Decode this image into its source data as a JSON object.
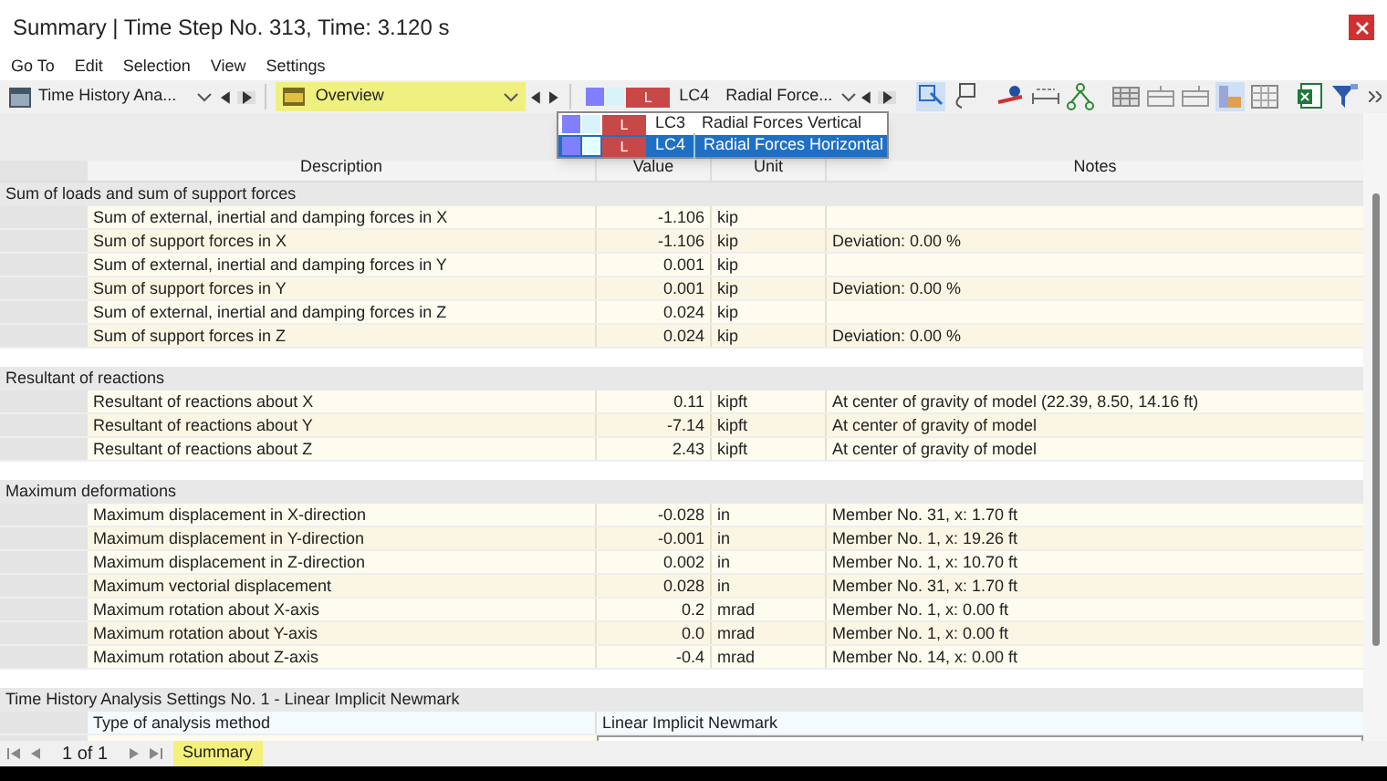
{
  "window": {
    "title": "Summary | Time Step No. 313, Time: 3.120 s"
  },
  "menu": [
    "Go To",
    "Edit",
    "Selection",
    "View",
    "Settings"
  ],
  "toolbar": {
    "analysis_combo": "Time History Ana...",
    "view_combo": "Overview",
    "load_case_combo": {
      "tag": "L",
      "code": "LC4",
      "name": "Radial Force..."
    },
    "load_case_list": [
      {
        "tag": "L",
        "code": "LC3",
        "name": "Radial Forces Vertical",
        "selected": false
      },
      {
        "tag": "L",
        "code": "LC4",
        "name": "Radial Forces Horizontal",
        "selected": true
      }
    ]
  },
  "table": {
    "columns": [
      "Description",
      "Value",
      "Unit",
      "Notes"
    ],
    "sections": [
      {
        "title": "Sum of loads and sum of support forces",
        "rows": [
          {
            "kind": "standard",
            "description": "Sum of external, inertial and damping forces in X",
            "value": "-1.106",
            "unit": "kip"
          },
          {
            "kind": "standard",
            "description": "Sum of support forces in X",
            "value": "-1.106",
            "unit": "kip",
            "notes": "Deviation: 0.00 %"
          },
          {
            "kind": "standard",
            "description": "Sum of external, inertial and damping forces in Y",
            "value": "0.001",
            "unit": "kip"
          },
          {
            "kind": "standard",
            "description": "Sum of support forces in Y",
            "value": "0.001",
            "unit": "kip",
            "notes": "Deviation: 0.00 %"
          },
          {
            "kind": "standard",
            "description": "Sum of external, inertial and damping forces in Z",
            "value": "0.024",
            "unit": "kip"
          },
          {
            "kind": "standard",
            "description": "Sum of support forces in Z",
            "value": "0.024",
            "unit": "kip",
            "notes": "Deviation: 0.00 %"
          }
        ]
      },
      {
        "title": "Resultant of reactions",
        "rows": [
          {
            "kind": "standard",
            "description": "Resultant of reactions about X",
            "value": "0.11",
            "unit": "kipft",
            "notes": "At center of gravity of model (22.39, 8.50, 14.16 ft)"
          },
          {
            "kind": "standard",
            "description": "Resultant of reactions about Y",
            "value": "-7.14",
            "unit": "kipft",
            "notes": "At center of gravity of model"
          },
          {
            "kind": "standard",
            "description": "Resultant of reactions about Z",
            "value": "2.43",
            "unit": "kipft",
            "notes": "At center of gravity of model"
          }
        ]
      },
      {
        "title": "Maximum deformations",
        "rows": [
          {
            "kind": "standard",
            "description": "Maximum displacement in X-direction",
            "value": "-0.028",
            "unit": "in",
            "notes": "Member No. 31, x: 1.70 ft"
          },
          {
            "kind": "standard",
            "description": "Maximum displacement in Y-direction",
            "value": "-0.001",
            "unit": "in",
            "notes": "Member No. 1, x: 19.26 ft"
          },
          {
            "kind": "standard",
            "description": "Maximum displacement in Z-direction",
            "value": "0.002",
            "unit": "in",
            "notes": "Member No. 1, x: 10.70 ft"
          },
          {
            "kind": "standard",
            "description": "Maximum vectorial displacement",
            "value": "0.028",
            "unit": "in",
            "notes": "Member No. 31, x: 1.70 ft"
          },
          {
            "kind": "standard",
            "description": "Maximum rotation about X-axis",
            "value": "0.2",
            "unit": "mrad",
            "notes": "Member No. 1, x: 0.00 ft"
          },
          {
            "kind": "standard",
            "description": "Maximum rotation about Y-axis",
            "value": "0.0",
            "unit": "mrad",
            "notes": "Member No. 1, x: 0.00 ft"
          },
          {
            "kind": "standard",
            "description": "Maximum rotation about Z-axis",
            "value": "-0.4",
            "unit": "mrad",
            "notes": "Member No. 14, x: 0.00 ft"
          }
        ]
      },
      {
        "title": "Time History Analysis Settings No. 1 - Linear Implicit Newmark",
        "rows": [
          {
            "kind": "merged",
            "description": "Type of analysis method",
            "value": "Linear Implicit Newmark"
          }
        ]
      }
    ]
  },
  "pager": {
    "text": "1 of 1"
  },
  "sheet_tabs": [
    {
      "label": "Summary",
      "selected": true
    }
  ]
}
